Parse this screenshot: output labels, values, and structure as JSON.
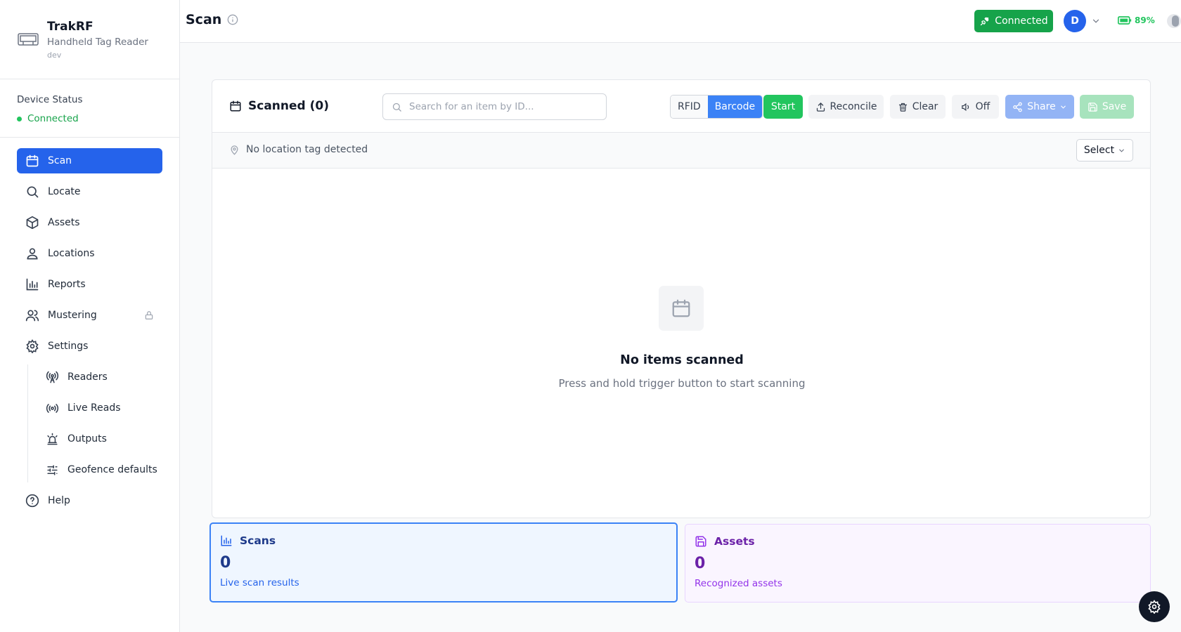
{
  "brand": {
    "title": "TrakRF",
    "subtitle": "Handheld Tag Reader",
    "env": "dev"
  },
  "device_status": {
    "label": "Device Status",
    "value": "Connected"
  },
  "nav": {
    "scan": "Scan",
    "locate": "Locate",
    "assets": "Assets",
    "locations": "Locations",
    "reports": "Reports",
    "mustering": "Mustering",
    "settings": "Settings",
    "readers": "Readers",
    "live_reads": "Live Reads",
    "outputs": "Outputs",
    "geofence": "Geofence defaults",
    "help": "Help"
  },
  "topbar": {
    "title": "Scan",
    "connected_label": "Connected",
    "avatar_initial": "D",
    "battery": "89%"
  },
  "card": {
    "title": "Scanned (0)",
    "search_placeholder": "Search for an item by ID...",
    "mode_rfid": "RFID",
    "mode_barcode": "Barcode",
    "start": "Start",
    "reconcile": "Reconcile",
    "clear": "Clear",
    "sound": "Off",
    "share": "Share",
    "save": "Save",
    "location_text": "No location tag detected",
    "select": "Select",
    "empty_title": "No items scanned",
    "empty_sub": "Press and hold trigger button to start scanning"
  },
  "stats": {
    "scans": {
      "title": "Scans",
      "value": "0",
      "sub": "Live scan results"
    },
    "assets": {
      "title": "Assets",
      "value": "0",
      "sub": "Recognized assets"
    }
  },
  "colors": {
    "accent": "#2563eb",
    "success": "#16a34a",
    "purple": "#9333ea"
  }
}
